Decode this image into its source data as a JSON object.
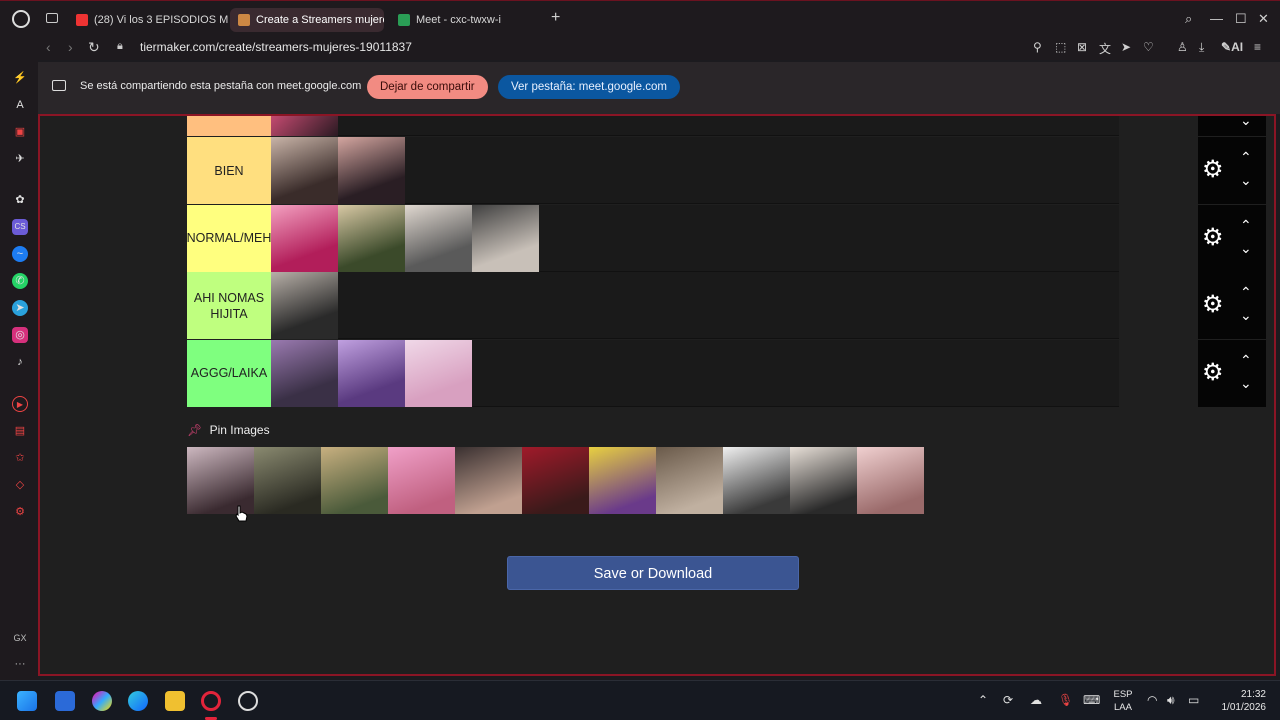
{
  "browser": {
    "tabs": [
      {
        "label": "(28) Vi los 3 EPISODIOS M",
        "icon": "youtube-icon",
        "color": "#e33"
      },
      {
        "label": "Create a Streamers mujere",
        "icon": "tiermaker-icon",
        "color": "#c84"
      },
      {
        "label": "Meet - cxc-twxw-i",
        "icon": "meet-icon",
        "color": "#2a9d55"
      }
    ],
    "new_tab": "+",
    "url": "tiermaker.com/create/streamers-mujeres-19011837",
    "toolbar_ai": "AI"
  },
  "share_bar": {
    "message": "Se está compartiendo esta pestaña con meet.google.com",
    "stop_label": "Dejar de compartir",
    "view_label": "Ver pestaña: meet.google.com"
  },
  "tiers": [
    {
      "label": "BIEN",
      "color": "#ffdf7f",
      "count": 2
    },
    {
      "label": "NORMAL/MEH",
      "color": "#ffff7f",
      "count": 4
    },
    {
      "label": "AHI NOMAS HIJITA",
      "color": "#bfff7f",
      "count": 1
    },
    {
      "label": "AGGG/LAIKA",
      "color": "#7fff7f",
      "count": 3
    }
  ],
  "pin_images": {
    "label": "Pin Images",
    "count": 11
  },
  "save_button": "Save or Download",
  "sidebar_labels": {
    "gx": "GX",
    "more": "···"
  },
  "taskbar": {
    "lang_top": "ESP",
    "lang_bottom": "LAA",
    "time": "21:32",
    "date": "1/01/2026"
  },
  "colors": {
    "accent_red": "#8b1525",
    "stop_share": "#f28b82",
    "view_tab": "#0b57a0",
    "save_button": "#3b5592"
  }
}
